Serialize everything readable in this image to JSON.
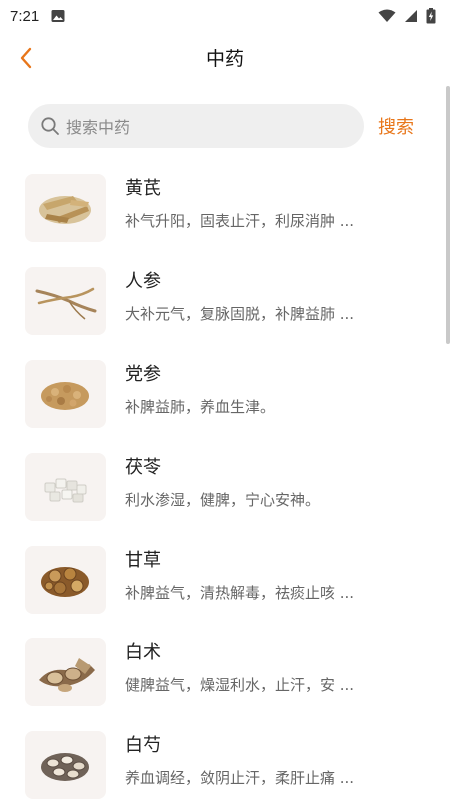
{
  "status_bar": {
    "time": "7:21",
    "icons": [
      "photo-icon",
      "wifi-icon",
      "signal-icon",
      "battery-charging-icon"
    ]
  },
  "header": {
    "title": "中药",
    "back_icon": "chevron-left-icon",
    "accent_color": "#e8761a"
  },
  "search": {
    "placeholder": "搜索中药",
    "button_label": "搜索"
  },
  "items": [
    {
      "name": "黄芪",
      "desc": "补气升阳，固表止汗，利尿消肿 ...",
      "thumb_icon": "huangqi-slices-image"
    },
    {
      "name": "人参",
      "desc": "大补元气，复脉固脱，补脾益肺 ...",
      "thumb_icon": "ginseng-root-image"
    },
    {
      "name": "党参",
      "desc": "补脾益肺，养血生津。",
      "thumb_icon": "dangshen-pieces-image"
    },
    {
      "name": "茯苓",
      "desc": "利水渗湿，健脾，宁心安神。",
      "thumb_icon": "fuling-cubes-image"
    },
    {
      "name": "甘草",
      "desc": "补脾益气，清热解毒，祛痰止咳 ...",
      "thumb_icon": "gancao-slices-image"
    },
    {
      "name": "白术",
      "desc": "健脾益气，燥湿利水，止汗，安 ...",
      "thumb_icon": "baizhu-slices-image"
    },
    {
      "name": "白芍",
      "desc": "养血调经，敛阴止汗，柔肝止痛 ...",
      "thumb_icon": "baishao-slices-image"
    }
  ]
}
